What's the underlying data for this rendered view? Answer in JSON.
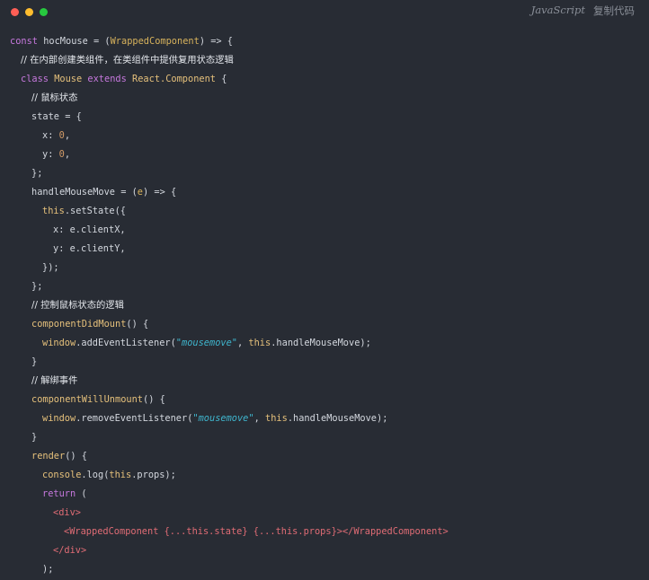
{
  "window": {
    "dots": [
      "#ff5f56",
      "#ffbd2e",
      "#27c93f"
    ]
  },
  "toolbar": {
    "language": "JavaScript",
    "copy_label": "复制代码"
  },
  "theme": {
    "background": "#282c34",
    "keyword": "#c678dd",
    "function": "#e5c07b",
    "string": "#3fb6ce",
    "number": "#d19a66",
    "tag": "#e06c75"
  },
  "code_lines": [
    {
      "indent": 0,
      "tokens": [
        {
          "t": "const ",
          "c": "kw"
        },
        {
          "t": "hocMouse = (",
          "c": "pl"
        },
        {
          "t": "WrappedComponent",
          "c": "tp"
        },
        {
          "t": ") => {",
          "c": "pl"
        }
      ]
    },
    {
      "indent": 1,
      "tokens": [
        {
          "t": "// 在内部创建类组件，在类组件中提供复用状态逻辑",
          "c": "cm"
        }
      ]
    },
    {
      "indent": 1,
      "tokens": [
        {
          "t": "class ",
          "c": "kw"
        },
        {
          "t": "Mouse ",
          "c": "fn"
        },
        {
          "t": "extends ",
          "c": "kw"
        },
        {
          "t": "React.Component",
          "c": "fn"
        },
        {
          "t": " {",
          "c": "pl"
        }
      ]
    },
    {
      "indent": 2,
      "tokens": [
        {
          "t": "// 鼠标状态",
          "c": "cm"
        }
      ]
    },
    {
      "indent": 2,
      "tokens": [
        {
          "t": "state = {",
          "c": "pl"
        }
      ]
    },
    {
      "indent": 3,
      "tokens": [
        {
          "t": "x: ",
          "c": "pl"
        },
        {
          "t": "0",
          "c": "num"
        },
        {
          "t": ",",
          "c": "pl"
        }
      ]
    },
    {
      "indent": 3,
      "tokens": [
        {
          "t": "y: ",
          "c": "pl"
        },
        {
          "t": "0",
          "c": "num"
        },
        {
          "t": ",",
          "c": "pl"
        }
      ]
    },
    {
      "indent": 2,
      "tokens": [
        {
          "t": "};",
          "c": "pl"
        }
      ]
    },
    {
      "indent": 2,
      "tokens": [
        {
          "t": "handleMouseMove = (",
          "c": "pl"
        },
        {
          "t": "e",
          "c": "tp"
        },
        {
          "t": ") => {",
          "c": "pl"
        }
      ]
    },
    {
      "indent": 3,
      "tokens": [
        {
          "t": "this",
          "c": "fn"
        },
        {
          "t": ".setState({",
          "c": "pl"
        }
      ]
    },
    {
      "indent": 4,
      "tokens": [
        {
          "t": "x: e.clientX,",
          "c": "pl"
        }
      ]
    },
    {
      "indent": 4,
      "tokens": [
        {
          "t": "y: e.clientY,",
          "c": "pl"
        }
      ]
    },
    {
      "indent": 3,
      "tokens": [
        {
          "t": "});",
          "c": "pl"
        }
      ]
    },
    {
      "indent": 2,
      "tokens": [
        {
          "t": "};",
          "c": "pl"
        }
      ]
    },
    {
      "indent": 2,
      "tokens": [
        {
          "t": "// 控制鼠标状态的逻辑",
          "c": "cm"
        }
      ]
    },
    {
      "indent": 2,
      "tokens": [
        {
          "t": "componentDidMount",
          "c": "fn"
        },
        {
          "t": "() {",
          "c": "pl"
        }
      ]
    },
    {
      "indent": 3,
      "tokens": [
        {
          "t": "window",
          "c": "fn"
        },
        {
          "t": ".addEventListener(",
          "c": "pl"
        },
        {
          "t": "\"mousemove\"",
          "c": "str"
        },
        {
          "t": ", ",
          "c": "pl"
        },
        {
          "t": "this",
          "c": "fn"
        },
        {
          "t": ".handleMouseMove);",
          "c": "pl"
        }
      ]
    },
    {
      "indent": 2,
      "tokens": [
        {
          "t": "}",
          "c": "pl"
        }
      ]
    },
    {
      "indent": 2,
      "tokens": [
        {
          "t": "// 解绑事件",
          "c": "cm"
        }
      ]
    },
    {
      "indent": 2,
      "tokens": [
        {
          "t": "componentWillUnmount",
          "c": "fn"
        },
        {
          "t": "() {",
          "c": "pl"
        }
      ]
    },
    {
      "indent": 3,
      "tokens": [
        {
          "t": "window",
          "c": "fn"
        },
        {
          "t": ".removeEventListener(",
          "c": "pl"
        },
        {
          "t": "\"mousemove\"",
          "c": "str"
        },
        {
          "t": ", ",
          "c": "pl"
        },
        {
          "t": "this",
          "c": "fn"
        },
        {
          "t": ".handleMouseMove);",
          "c": "pl"
        }
      ]
    },
    {
      "indent": 2,
      "tokens": [
        {
          "t": "}",
          "c": "pl"
        }
      ]
    },
    {
      "indent": 2,
      "tokens": [
        {
          "t": "render",
          "c": "fn"
        },
        {
          "t": "() {",
          "c": "pl"
        }
      ]
    },
    {
      "indent": 3,
      "tokens": [
        {
          "t": "console",
          "c": "fn"
        },
        {
          "t": ".log(",
          "c": "pl"
        },
        {
          "t": "this",
          "c": "fn"
        },
        {
          "t": ".props);",
          "c": "pl"
        }
      ]
    },
    {
      "indent": 3,
      "tokens": [
        {
          "t": "return",
          "c": "kw"
        },
        {
          "t": " (",
          "c": "pl"
        }
      ]
    },
    {
      "indent": 4,
      "tokens": [
        {
          "t": "<div>",
          "c": "tag"
        }
      ]
    },
    {
      "indent": 5,
      "tokens": [
        {
          "t": "<WrappedComponent {...this.state} {...this.props}></WrappedComponent>",
          "c": "tag"
        }
      ]
    },
    {
      "indent": 4,
      "tokens": [
        {
          "t": "</div>",
          "c": "tag"
        }
      ]
    },
    {
      "indent": 3,
      "tokens": [
        {
          "t": ");",
          "c": "pl"
        }
      ]
    }
  ]
}
